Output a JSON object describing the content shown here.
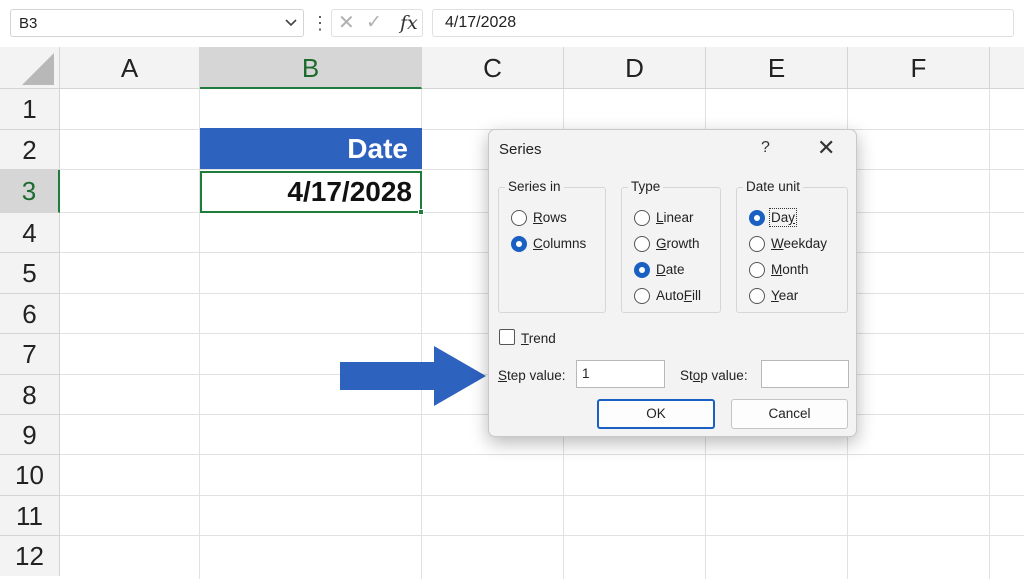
{
  "formula_bar": {
    "name_box": "B3",
    "fx_symbol": "fx",
    "formula": "4/17/2028"
  },
  "sheet": {
    "columns": [
      "A",
      "B",
      "C",
      "D",
      "E",
      "F"
    ],
    "selected_column": "B",
    "rows": [
      "1",
      "2",
      "3",
      "4",
      "5",
      "6",
      "7",
      "8",
      "9",
      "10",
      "11",
      "12"
    ],
    "selected_row": "3",
    "header_cell": "Date",
    "date_cell": "4/17/2028",
    "header_fill_color": "#2e62bf",
    "selection_color": "#1e7d3a"
  },
  "arrow": {
    "icon": "right-arrow-icon",
    "color": "#2e62bf"
  },
  "dialog": {
    "title": "Series",
    "help": "?",
    "close": "✕",
    "series_in": {
      "title": "Series in",
      "options": [
        "Rows",
        "Columns"
      ],
      "selected": "Columns"
    },
    "type": {
      "title": "Type",
      "options": [
        "Linear",
        "Growth",
        "Date",
        "AutoFill"
      ],
      "selected": "Date"
    },
    "date_unit": {
      "title": "Date unit",
      "options": [
        "Day",
        "Weekday",
        "Month",
        "Year"
      ],
      "selected": "Day"
    },
    "trend_label": "Trend",
    "trend_checked": false,
    "step_label": "Step value:",
    "step_value": "1",
    "stop_label": "Stop value:",
    "stop_value": "",
    "ok_label": "OK",
    "cancel_label": "Cancel"
  }
}
